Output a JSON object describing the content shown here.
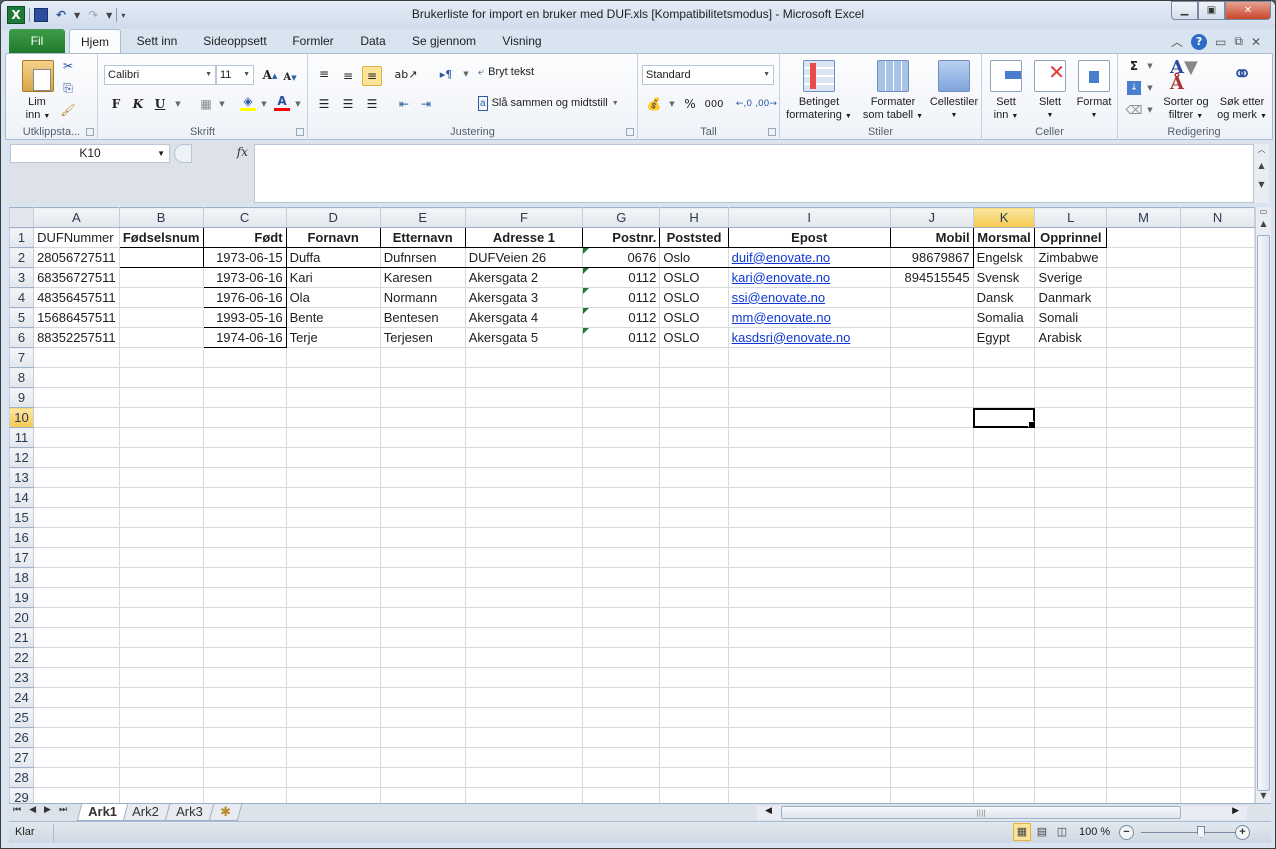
{
  "window": {
    "title": "Brukerliste for import en bruker med DUF.xls  [Kompatibilitetsmodus]  -  Microsoft Excel",
    "controls": {
      "minimize": "minimize-icon",
      "maximize": "restore-icon",
      "close": "close-icon"
    }
  },
  "quick_access": [
    "excel-logo-icon",
    "save-icon",
    "undo-icon",
    "redo-icon",
    "customize-qat-icon"
  ],
  "tabs": [
    {
      "label": "Fil",
      "active": false
    },
    {
      "label": "Hjem",
      "active": true
    },
    {
      "label": "Sett inn",
      "active": false
    },
    {
      "label": "Sideoppsett",
      "active": false
    },
    {
      "label": "Formler",
      "active": false
    },
    {
      "label": "Data",
      "active": false
    },
    {
      "label": "Se gjennom",
      "active": false
    },
    {
      "label": "Visning",
      "active": false
    }
  ],
  "ribbon": {
    "clipboard": {
      "label": "Utklippsta...",
      "paste_line1": "Lim",
      "paste_line2": "inn"
    },
    "font": {
      "label": "Skrift",
      "font_name": "Calibri",
      "font_size": "11",
      "bold": "F",
      "italic": "K",
      "underline": "U",
      "grow": "A",
      "shrink": "A",
      "highlight_color": "#ffff00",
      "font_color": "#ff0000"
    },
    "alignment": {
      "label": "Justering",
      "wrap_text": "Bryt tekst",
      "merge_center": "Slå sammen og midtstill"
    },
    "number": {
      "label": "Tall",
      "format": "Standard",
      "percent": "%",
      "thousands": "000",
      "inc_decimal": ",0",
      "dec_decimal": ",00"
    },
    "styles": {
      "label": "Stiler",
      "conditional_1": "Betinget",
      "conditional_2": "formatering",
      "table_1": "Formater",
      "table_2": "som tabell",
      "cell_styles": "Cellestiler"
    },
    "cells": {
      "label": "Celler",
      "insert_1": "Sett",
      "insert_2": "inn",
      "delete": "Slett",
      "format": "Format"
    },
    "editing": {
      "label": "Redigering",
      "autosum": "Σ",
      "sort_1": "Sorter og",
      "sort_2": "filtrer",
      "find_1": "Søk etter",
      "find_2": "og merk"
    }
  },
  "formula_bar": {
    "name_box": "K10",
    "fx": "fx",
    "formula": ""
  },
  "grid": {
    "columns": [
      "A",
      "B",
      "C",
      "D",
      "E",
      "F",
      "G",
      "H",
      "I",
      "J",
      "K",
      "L",
      "M",
      "N"
    ],
    "selected_column": "K",
    "selected_row": 10,
    "selected_cell": "K10",
    "rows": [
      [
        "DUFNummer",
        "Fødselsnum",
        "Født",
        "Fornavn",
        "Etternavn",
        "Adresse 1",
        "Postnr.",
        "Poststed",
        "Epost",
        "Mobil",
        "Morsmal",
        "Opprinnel",
        "",
        ""
      ],
      [
        "28056727511",
        "",
        "1973-06-15",
        "Duffa",
        "Dufnrsen",
        "DUFVeien 26",
        "0676",
        "Oslo",
        "duif@enovate.no",
        "98679867",
        "Engelsk",
        "Zimbabwe",
        "",
        ""
      ],
      [
        "68356727511",
        "",
        "1973-06-16",
        "Kari",
        "Karesen",
        "Akersgata 2",
        "0112",
        "OSLO",
        "kari@enovate.no",
        "894515545",
        "Svensk",
        "Sverige",
        "",
        ""
      ],
      [
        "48356457511",
        "",
        "1976-06-16",
        "Ola",
        "Normann",
        "Akersgata 3",
        "0112",
        "OSLO",
        "ssi@enovate.no",
        "",
        "Dansk",
        "Danmark",
        "",
        ""
      ],
      [
        "15686457511",
        "",
        "1993-05-16",
        "Bente",
        "Bentesen",
        "Akersgata 4",
        "0112",
        "OSLO",
        "mm@enovate.no",
        "",
        "Somalia",
        "Somali",
        "",
        ""
      ],
      [
        "88352257511",
        "",
        "1974-06-16",
        "Terje",
        "Terjesen",
        "Akersgata 5",
        "0112",
        "OSLO",
        "kasdsri@enovate.no",
        "",
        "Egypt",
        "Arabisk",
        "",
        ""
      ]
    ],
    "total_visible_rows": 29
  },
  "sheets": [
    {
      "label": "Ark1",
      "active": true
    },
    {
      "label": "Ark2",
      "active": false
    },
    {
      "label": "Ark3",
      "active": false
    }
  ],
  "status": {
    "text": "Klar",
    "zoom": "100 %",
    "zoom_value_percent": 100
  }
}
